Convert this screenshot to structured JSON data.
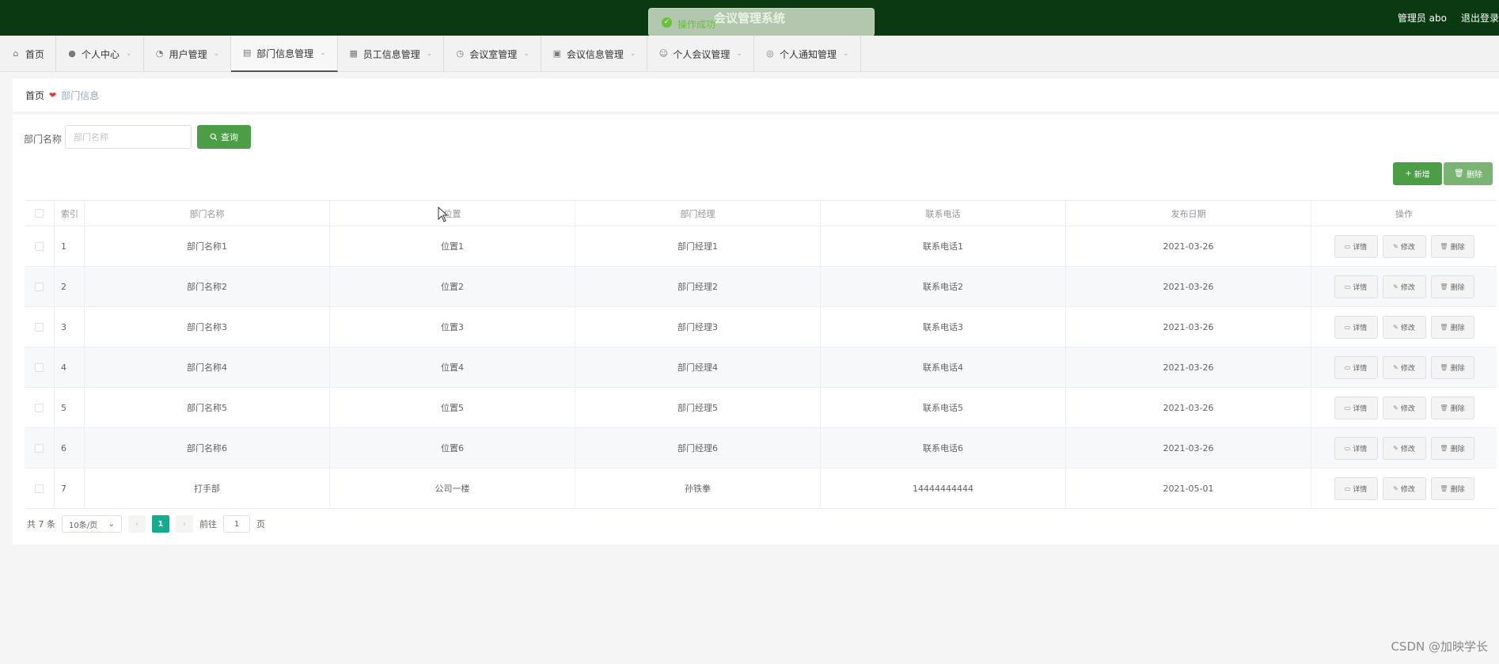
{
  "header": {
    "title": "会议管理系统",
    "user_label": "管理员 abo",
    "logout_label": "退出登录"
  },
  "toast": {
    "text": "操作成功"
  },
  "nav": {
    "items": [
      {
        "label": "首页",
        "icon": "home-icon"
      },
      {
        "label": "个人中心",
        "icon": "user-icon"
      },
      {
        "label": "用户管理",
        "icon": "user-manage-icon"
      },
      {
        "label": "部门信息管理",
        "icon": "department-icon"
      },
      {
        "label": "员工信息管理",
        "icon": "employee-icon"
      },
      {
        "label": "会议室管理",
        "icon": "clock-icon"
      },
      {
        "label": "会议信息管理",
        "icon": "meeting-icon"
      },
      {
        "label": "个人会议管理",
        "icon": "personal-meeting-icon"
      },
      {
        "label": "个人通知管理",
        "icon": "notice-icon"
      }
    ],
    "active_index": 3
  },
  "breadcrumb": {
    "home": "首页",
    "current": "部门信息"
  },
  "search": {
    "label": "部门名称",
    "placeholder": "部门名称",
    "button": "查询"
  },
  "actions": {
    "add": "新增",
    "delete": "删除"
  },
  "table": {
    "columns": [
      "索引",
      "部门名称",
      "位置",
      "部门经理",
      "联系电话",
      "发布日期",
      "操作"
    ],
    "rows": [
      {
        "index": "1",
        "name": "部门名称1",
        "location": "位置1",
        "manager": "部门经理1",
        "phone": "联系电话1",
        "date": "2021-03-26"
      },
      {
        "index": "2",
        "name": "部门名称2",
        "location": "位置2",
        "manager": "部门经理2",
        "phone": "联系电话2",
        "date": "2021-03-26"
      },
      {
        "index": "3",
        "name": "部门名称3",
        "location": "位置3",
        "manager": "部门经理3",
        "phone": "联系电话3",
        "date": "2021-03-26"
      },
      {
        "index": "4",
        "name": "部门名称4",
        "location": "位置4",
        "manager": "部门经理4",
        "phone": "联系电话4",
        "date": "2021-03-26"
      },
      {
        "index": "5",
        "name": "部门名称5",
        "location": "位置5",
        "manager": "部门经理5",
        "phone": "联系电话5",
        "date": "2021-03-26"
      },
      {
        "index": "6",
        "name": "部门名称6",
        "location": "位置6",
        "manager": "部门经理6",
        "phone": "联系电话6",
        "date": "2021-03-26"
      },
      {
        "index": "7",
        "name": "打手部",
        "location": "公司一楼",
        "manager": "孙铁拳",
        "phone": "14444444444",
        "date": "2021-05-01"
      }
    ],
    "row_actions": {
      "detail": "详情",
      "edit": "修改",
      "delete": "删除"
    }
  },
  "pagination": {
    "total": "共 7 条",
    "page_size": "10条/页",
    "current_page": "1",
    "goto_prefix": "前往",
    "goto_value": "1",
    "goto_suffix": "页"
  },
  "watermark": "CSDN @加映学长",
  "colors": {
    "header_bg": "#0b3a12",
    "primary": "#4c9e46",
    "page_active": "#13ac8e"
  }
}
